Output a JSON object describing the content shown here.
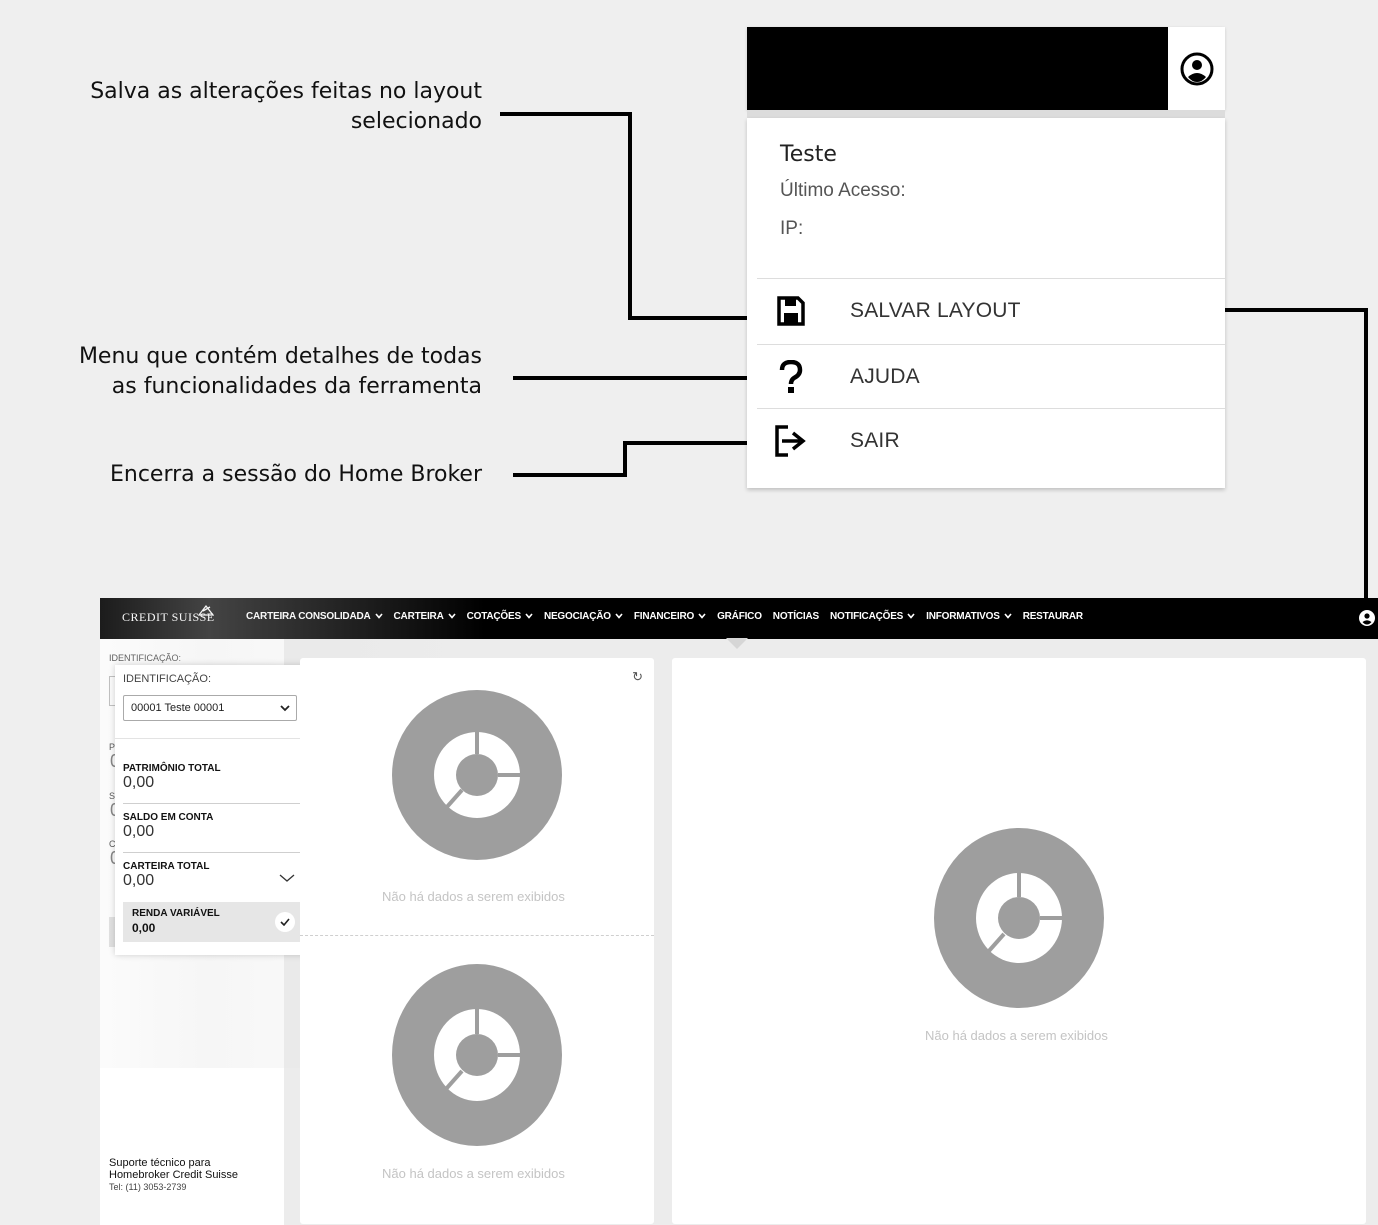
{
  "callouts": {
    "salvar": [
      "Salva as alterações feitas no layout",
      "selecionado"
    ],
    "ajuda": [
      "Menu que contém detalhes de todas",
      "as funcionalidades da ferramenta"
    ],
    "sair": [
      "Encerra a sessão do Home Broker"
    ]
  },
  "user_menu": {
    "name": "Teste",
    "last_access_label": "Último Acesso:",
    "ip_label": "IP:",
    "items": [
      {
        "icon": "floppy-disk-icon",
        "label": "SALVAR LAYOUT"
      },
      {
        "icon": "question-mark-icon",
        "label": "AJUDA"
      },
      {
        "icon": "logout-icon",
        "label": "SAIR"
      }
    ]
  },
  "navbar": {
    "logo": "CREDIT SUISSE",
    "items": [
      {
        "label": "CARTEIRA CONSOLIDADA",
        "dropdown": true
      },
      {
        "label": "CARTEIRA",
        "dropdown": true
      },
      {
        "label": "COTAÇÕES",
        "dropdown": true
      },
      {
        "label": "NEGOCIAÇÃO",
        "dropdown": true
      },
      {
        "label": "FINANCEIRO",
        "dropdown": true
      },
      {
        "label": "GRÁFICO",
        "dropdown": false
      },
      {
        "label": "NOTÍCIAS",
        "dropdown": false
      },
      {
        "label": "NOTIFICAÇÕES",
        "dropdown": true
      },
      {
        "label": "INFORMATIVOS",
        "dropdown": true
      },
      {
        "label": "RESTAURAR",
        "dropdown": false
      }
    ]
  },
  "sidebar": {
    "label": "IDENTIFICAÇÃO:",
    "selected_account": "00001 Teste 00001",
    "under_letters": [
      "P",
      "S",
      "C"
    ],
    "under_values": [
      "0",
      "0",
      "0"
    ],
    "items": [
      {
        "label": "PATRIMÔNIO TOTAL",
        "value": "0,00"
      },
      {
        "label": "SALDO EM CONTA",
        "value": "0,00"
      },
      {
        "label": "CARTEIRA TOTAL",
        "value": "0,00"
      }
    ],
    "sub_item": {
      "label": "RENDA VARIÁVEL",
      "value": "0,00"
    },
    "support": {
      "line1": "Suporte técnico para",
      "line2": "Homebroker Credit Suisse",
      "tel": "Tel: (11) 3053-2739"
    }
  },
  "widgets": {
    "empty_message": "Não há dados a serem exibidos",
    "refresh_icon": "↻"
  },
  "colors": {
    "navbar": "#000000",
    "donut": "#9e9e9e",
    "empty_text": "#c4c4c4"
  }
}
